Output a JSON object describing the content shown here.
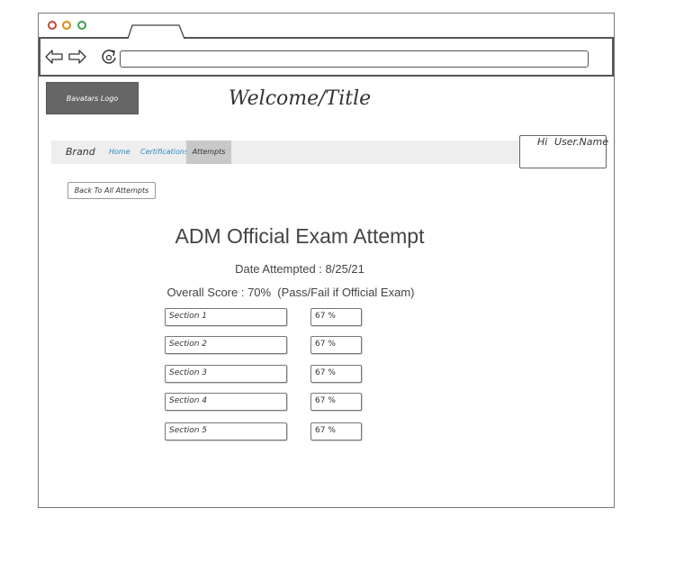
{
  "header": {
    "logo_text": "Bavatars Logo",
    "title": "Welcome/Title"
  },
  "nav": {
    "brand": "Brand",
    "home": "Home",
    "certifications": "Certifications",
    "attempts": "Attempts"
  },
  "user": {
    "greeting": "Hi",
    "name": "User.Name"
  },
  "back_button": "Back To All Attempts",
  "exam": {
    "title": "ADM Official Exam Attempt",
    "date": "Date Attempted : 8/25/21",
    "overall": "Overall Score : 70%  (Pass/Fail if Official Exam)",
    "sections": [
      {
        "name": "Section 1",
        "score": "67 %"
      },
      {
        "name": "Section 2",
        "score": "67 %"
      },
      {
        "name": "Section 3",
        "score": "67 %"
      },
      {
        "name": "Section 4",
        "score": "67 %"
      },
      {
        "name": "Section 5",
        "score": "67 %"
      }
    ]
  },
  "icons": {
    "window_controls": [
      "close-dot",
      "minimize-dot",
      "maximize-dot"
    ],
    "nav": [
      "arrow-left-icon",
      "arrow-right-icon",
      "reload-icon"
    ]
  },
  "colors": {
    "dot_red": "#c4463a",
    "dot_orange": "#dd8a1a",
    "dot_green": "#3aa14a",
    "link_blue": "#2b86c5",
    "active_tab": "#c8c8c8",
    "logo_bg": "#666666"
  }
}
